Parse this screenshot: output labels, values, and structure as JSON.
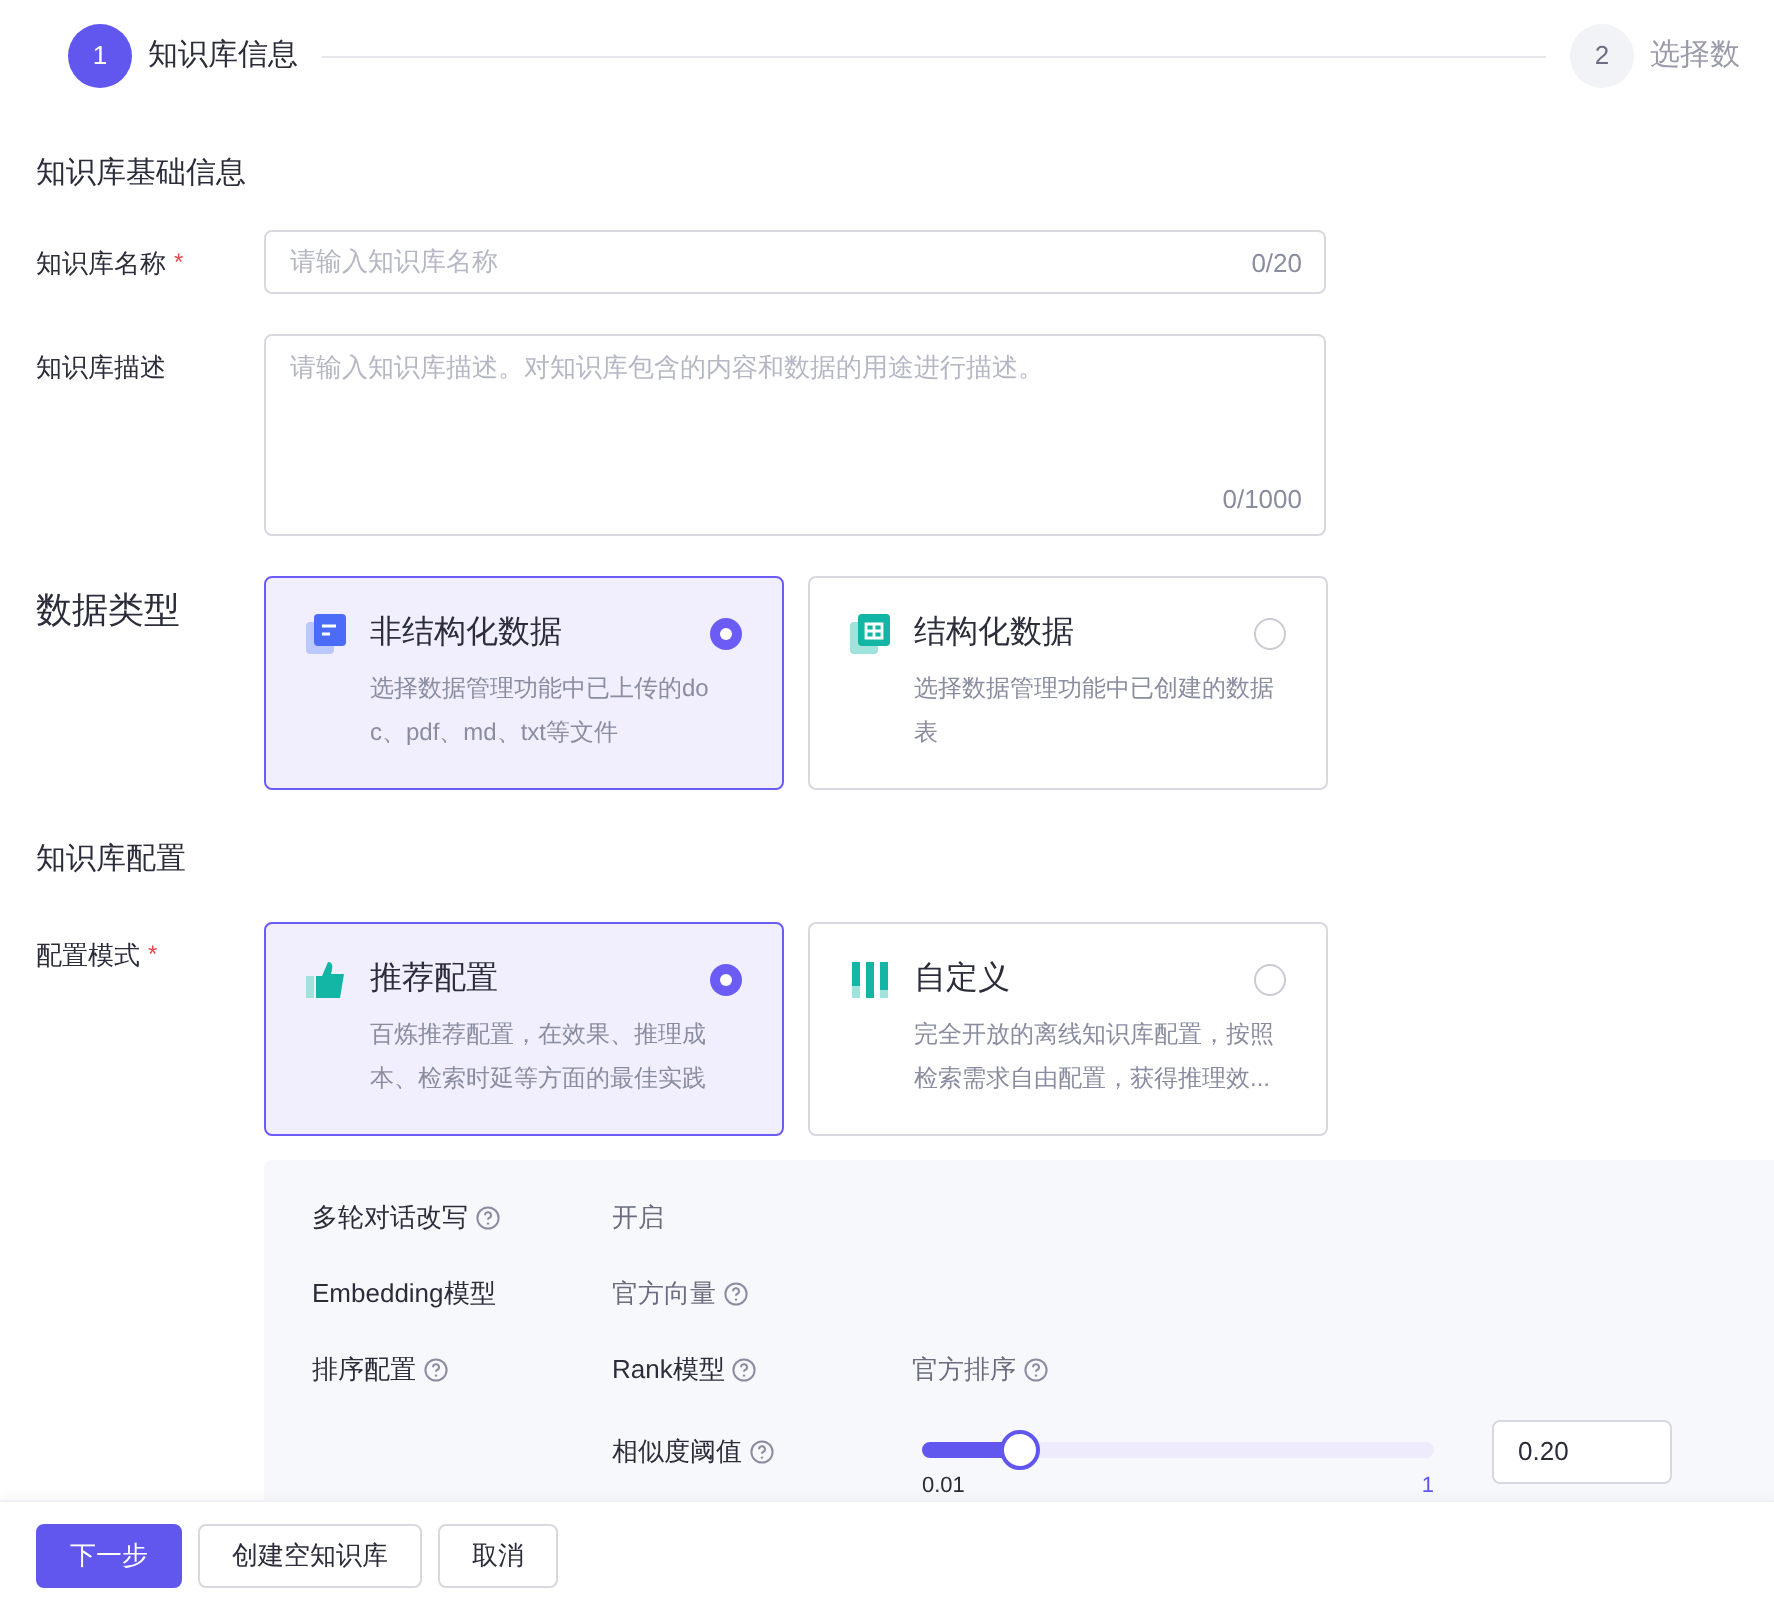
{
  "steps": [
    {
      "number": "1",
      "label": "知识库信息",
      "selected": true
    },
    {
      "number": "2",
      "label": "选择数",
      "selected": false
    }
  ],
  "basic_section": {
    "title": "知识库基础信息"
  },
  "name_field": {
    "label": "知识库名称",
    "required_mark": "*",
    "placeholder": "请输入知识库名称",
    "counter": "0/20"
  },
  "description_field": {
    "label": "知识库描述",
    "placeholder": "请输入知识库描述。对知识库包含的内容和数据的用途进行描述。",
    "counter": "0/1000"
  },
  "data_type": {
    "label": "数据类型",
    "options": [
      {
        "kind": "document",
        "title": "非结构化数据",
        "description": "选择数据管理功能中已上传的doc、pdf、md、txt等文件",
        "selected": true
      },
      {
        "kind": "table",
        "title": "结构化数据",
        "description": "选择数据管理功能中已创建的数据表",
        "selected": false
      }
    ]
  },
  "config_section": {
    "title": "知识库配置"
  },
  "config_mode": {
    "label": "配置模式",
    "required_mark": "*",
    "options": [
      {
        "kind": "thumb",
        "title": "推荐配置",
        "description": "百炼推荐配置，在效果、推理成本、检索时延等方面的最佳实践",
        "selected": true
      },
      {
        "kind": "bars",
        "title": "自定义",
        "description": "完全开放的离线知识库配置，按照检索需求自由配置，获得推理效...",
        "selected": false
      }
    ]
  },
  "config_details": {
    "rows": [
      {
        "label": "多轮对话改写",
        "help": true,
        "value": "开启",
        "value_help": false
      },
      {
        "label": "Embedding模型",
        "help": false,
        "value": "官方向量",
        "value_help": true
      }
    ],
    "ranking": {
      "label": "排序配置",
      "rank_label": "Rank模型",
      "rank_value": "官方排序",
      "threshold_label": "相似度阈值",
      "level": 0.19,
      "min": "0.01",
      "max": "1",
      "value": "0.20"
    }
  },
  "footer": {
    "buttons": [
      {
        "label": "下一步",
        "kind": "primary"
      },
      {
        "label": "创建空知识库",
        "kind": "default"
      },
      {
        "label": "取消",
        "kind": "default"
      }
    ]
  }
}
